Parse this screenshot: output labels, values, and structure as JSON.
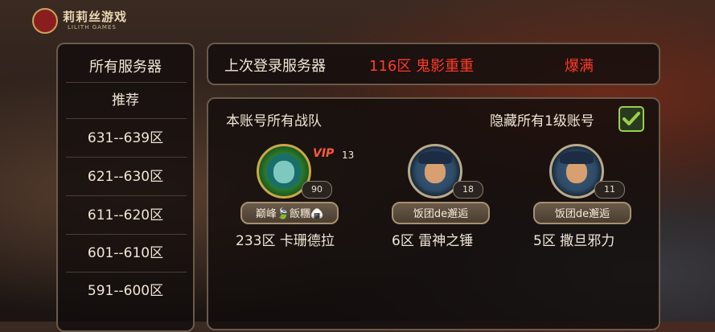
{
  "logo": {
    "name": "莉莉丝游戏",
    "subtitle": "LILITH GAMES"
  },
  "sidebar": {
    "title": "所有服务器",
    "items": [
      {
        "label": "推荐"
      },
      {
        "label": "631--639区"
      },
      {
        "label": "621--630区"
      },
      {
        "label": "611--620区"
      },
      {
        "label": "601--610区"
      },
      {
        "label": "591--600区"
      }
    ]
  },
  "recent": {
    "label": "上次登录服务器",
    "server": "116区 鬼影重重",
    "status": "爆满"
  },
  "teams": {
    "label": "本账号所有战队",
    "hide_label": "隐藏所有1级账号",
    "hide_checked": true,
    "items": [
      {
        "level": "90",
        "vip_label": "VIP",
        "vip_level": "13",
        "player": "巅峰🍃飯糰🍙",
        "server": "233区 卡珊德拉",
        "avatar": "wreath-avatar-icon"
      },
      {
        "level": "18",
        "player": "饭团de邂逅",
        "server": "6区 雷神之锤",
        "avatar": "pirate-avatar-icon"
      },
      {
        "level": "11",
        "player": "饭团de邂逅",
        "server": "5区 撒旦邪力",
        "avatar": "pirate-avatar-icon"
      }
    ]
  },
  "colors": {
    "highlight": "#ff3a2a",
    "check": "#9ad04a"
  }
}
